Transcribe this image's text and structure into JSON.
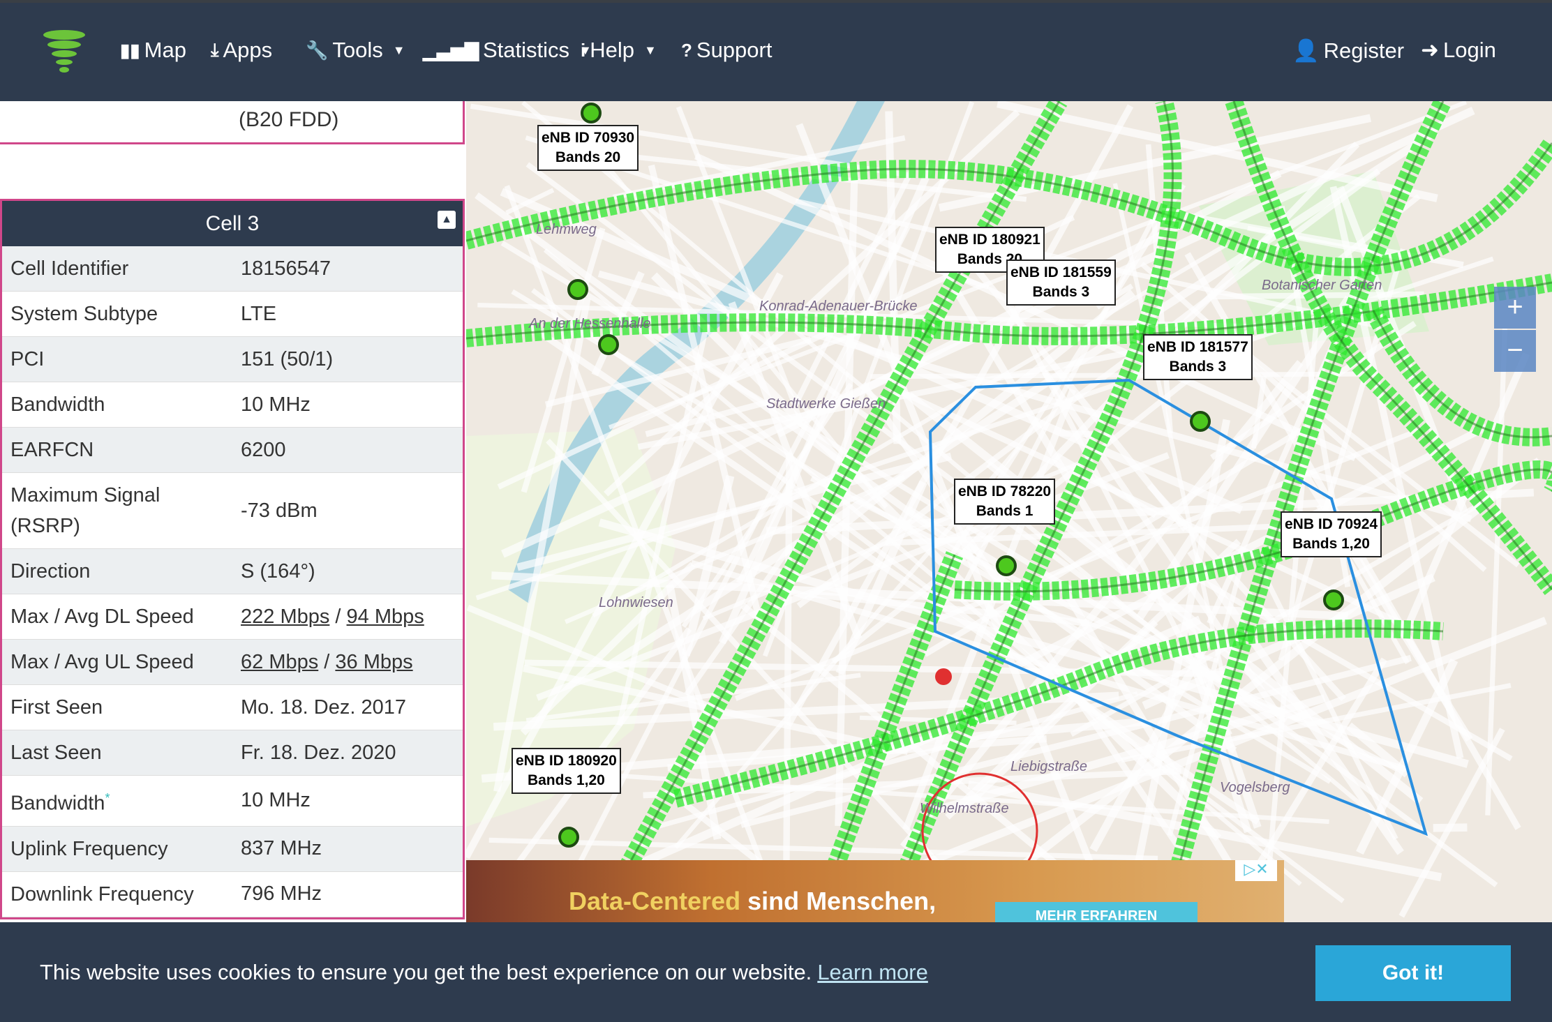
{
  "nav": {
    "items": [
      {
        "label": "Map",
        "icon": "map-icon",
        "glyph": "▮▮"
      },
      {
        "label": "Apps",
        "icon": "download-icon",
        "glyph": "⤓"
      },
      {
        "label": "Tools",
        "icon": "wrench-icon",
        "glyph": "🔧",
        "dropdown": true
      },
      {
        "label": "Statistics",
        "icon": "signal-icon",
        "glyph": "▁▃▅▇",
        "dropdown": true
      },
      {
        "label": "Help",
        "icon": "info-icon",
        "glyph": "i",
        "dropdown": true
      },
      {
        "label": "Support",
        "icon": "question-icon",
        "glyph": "?"
      }
    ],
    "register": "Register",
    "login": "Login"
  },
  "left": {
    "prev_value": "(B20 FDD)",
    "cell_title": "Cell 3",
    "rows": [
      {
        "k": "Cell Identifier",
        "v": "18156547"
      },
      {
        "k": "System Subtype",
        "v": "LTE"
      },
      {
        "k": "PCI",
        "v": "151 (50/1)"
      },
      {
        "k": "Bandwidth",
        "v": "10 MHz"
      },
      {
        "k": "EARFCN",
        "v": "6200"
      },
      {
        "k": "Maximum Signal (RSRP)",
        "v": "-73 dBm"
      },
      {
        "k": "Direction",
        "v": "S (164°)"
      },
      {
        "k": "Max / Avg DL Speed",
        "v1": "222 Mbps",
        "v2": "94 Mbps"
      },
      {
        "k": "Max / Avg UL Speed",
        "v1": "62 Mbps",
        "v2": "36 Mbps"
      },
      {
        "k": "First Seen",
        "v": "Mo. 18. Dez. 2017"
      },
      {
        "k": "Last Seen",
        "v": "Fr. 18. Dez. 2020"
      },
      {
        "k": "Bandwidth",
        "v": "10 MHz",
        "mark": "*"
      },
      {
        "k": "Uplink Frequency",
        "v": "837 MHz"
      },
      {
        "k": "Downlink Frequency",
        "v": "796 MHz"
      }
    ]
  },
  "map": {
    "sites": [
      {
        "id": "eNB ID 70930",
        "bands": "Bands 20"
      },
      {
        "id": "eNB ID 180921",
        "bands": "Bands 20"
      },
      {
        "id": "eNB ID 181559",
        "bands": "Bands 3"
      },
      {
        "id": "eNB ID 181577",
        "bands": "Bands 3"
      },
      {
        "id": "eNB ID 78220",
        "bands": "Bands 1"
      },
      {
        "id": "eNB ID 70924",
        "bands": "Bands 1,20"
      },
      {
        "id": "eNB ID 180920",
        "bands": "Bands 1,20"
      }
    ],
    "zoom_in": "+",
    "zoom_out": "−",
    "places": [
      "Konrad-Adenauer-Brücke",
      "Stadtwerke Gießen",
      "Botanischer Garten",
      "Lohnwiesen",
      "Lehmweg",
      "An der Hessenhalle",
      "Wilhelmstraße",
      "Liebigstraße",
      "Vogelsberg"
    ],
    "coverage_color": "#2ee82e",
    "cell_outline_color": "#2a8fe0"
  },
  "ad": {
    "headline_accent": "Data-Centered",
    "headline": " sind Menschen,",
    "button": "MEHR ERFAHREN"
  },
  "cookie": {
    "text": "This website uses cookies to ensure you get the best experience on our website.",
    "link": "Learn more",
    "button": "Got it!"
  }
}
